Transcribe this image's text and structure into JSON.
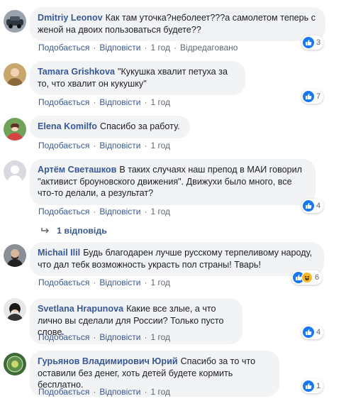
{
  "actions": {
    "like": "Подобається",
    "reply": "Відповісти"
  },
  "colors": {
    "link": "#385898",
    "bubble": "#f2f3f5",
    "meta": "#606770",
    "like_reaction": "#1877f2",
    "haha_reaction": "#f7b928"
  },
  "comments": [
    {
      "author": "Dmitriy Leonov",
      "text": "Как там уточка?неболеет???а самолетом теперь с женой на двоих пользоваться будете??",
      "time": "1 год",
      "edited": "Відредаговано",
      "reactions": "3",
      "avatar_icon": "car-avatar-icon"
    },
    {
      "author": "Tamara Grishkova",
      "text": "\"Кукушка хвалит петуха за то, что хвалит он кукушку\"",
      "time": "1 год",
      "reactions": "7",
      "avatar_icon": "person-avatar-icon"
    },
    {
      "author": "Elena Komilfo",
      "text": "Спасибо за работу.",
      "time": "1 год",
      "avatar_icon": "person-avatar-icon"
    },
    {
      "author": "Артём Светашков",
      "text": "В таких случаях наш препод в МАИ говорил \"активист броуновского движения\". Движухи было много, все что-то делали, а результат?",
      "time": "1 год",
      "reactions": "4",
      "avatar_icon": "default-avatar-icon"
    },
    {
      "author": "Michail Ilil",
      "text": "Будь благодарен лучше русскому терпеливому народу, что дал тебк возможность украсть пол страны! Тварь!",
      "time": "1 год",
      "reactions": "6",
      "avatar_icon": "person-avatar-icon"
    },
    {
      "author": "Svetlana Hrapunova",
      "text": "Какие все злые, а что лично вы сделали для России? Только пусто слове.",
      "time": "1 год",
      "reactions": "4",
      "avatar_icon": "person-avatar-icon"
    },
    {
      "author": "Гурьянов Владимирович Юрий",
      "text": "Спасибо за то что оставили без денег, хоть детей будете кормить бесплатно.",
      "time": "1 год",
      "reactions": "1",
      "avatar_icon": "badge-avatar-icon"
    }
  ],
  "replies_link": "1 відповідь"
}
